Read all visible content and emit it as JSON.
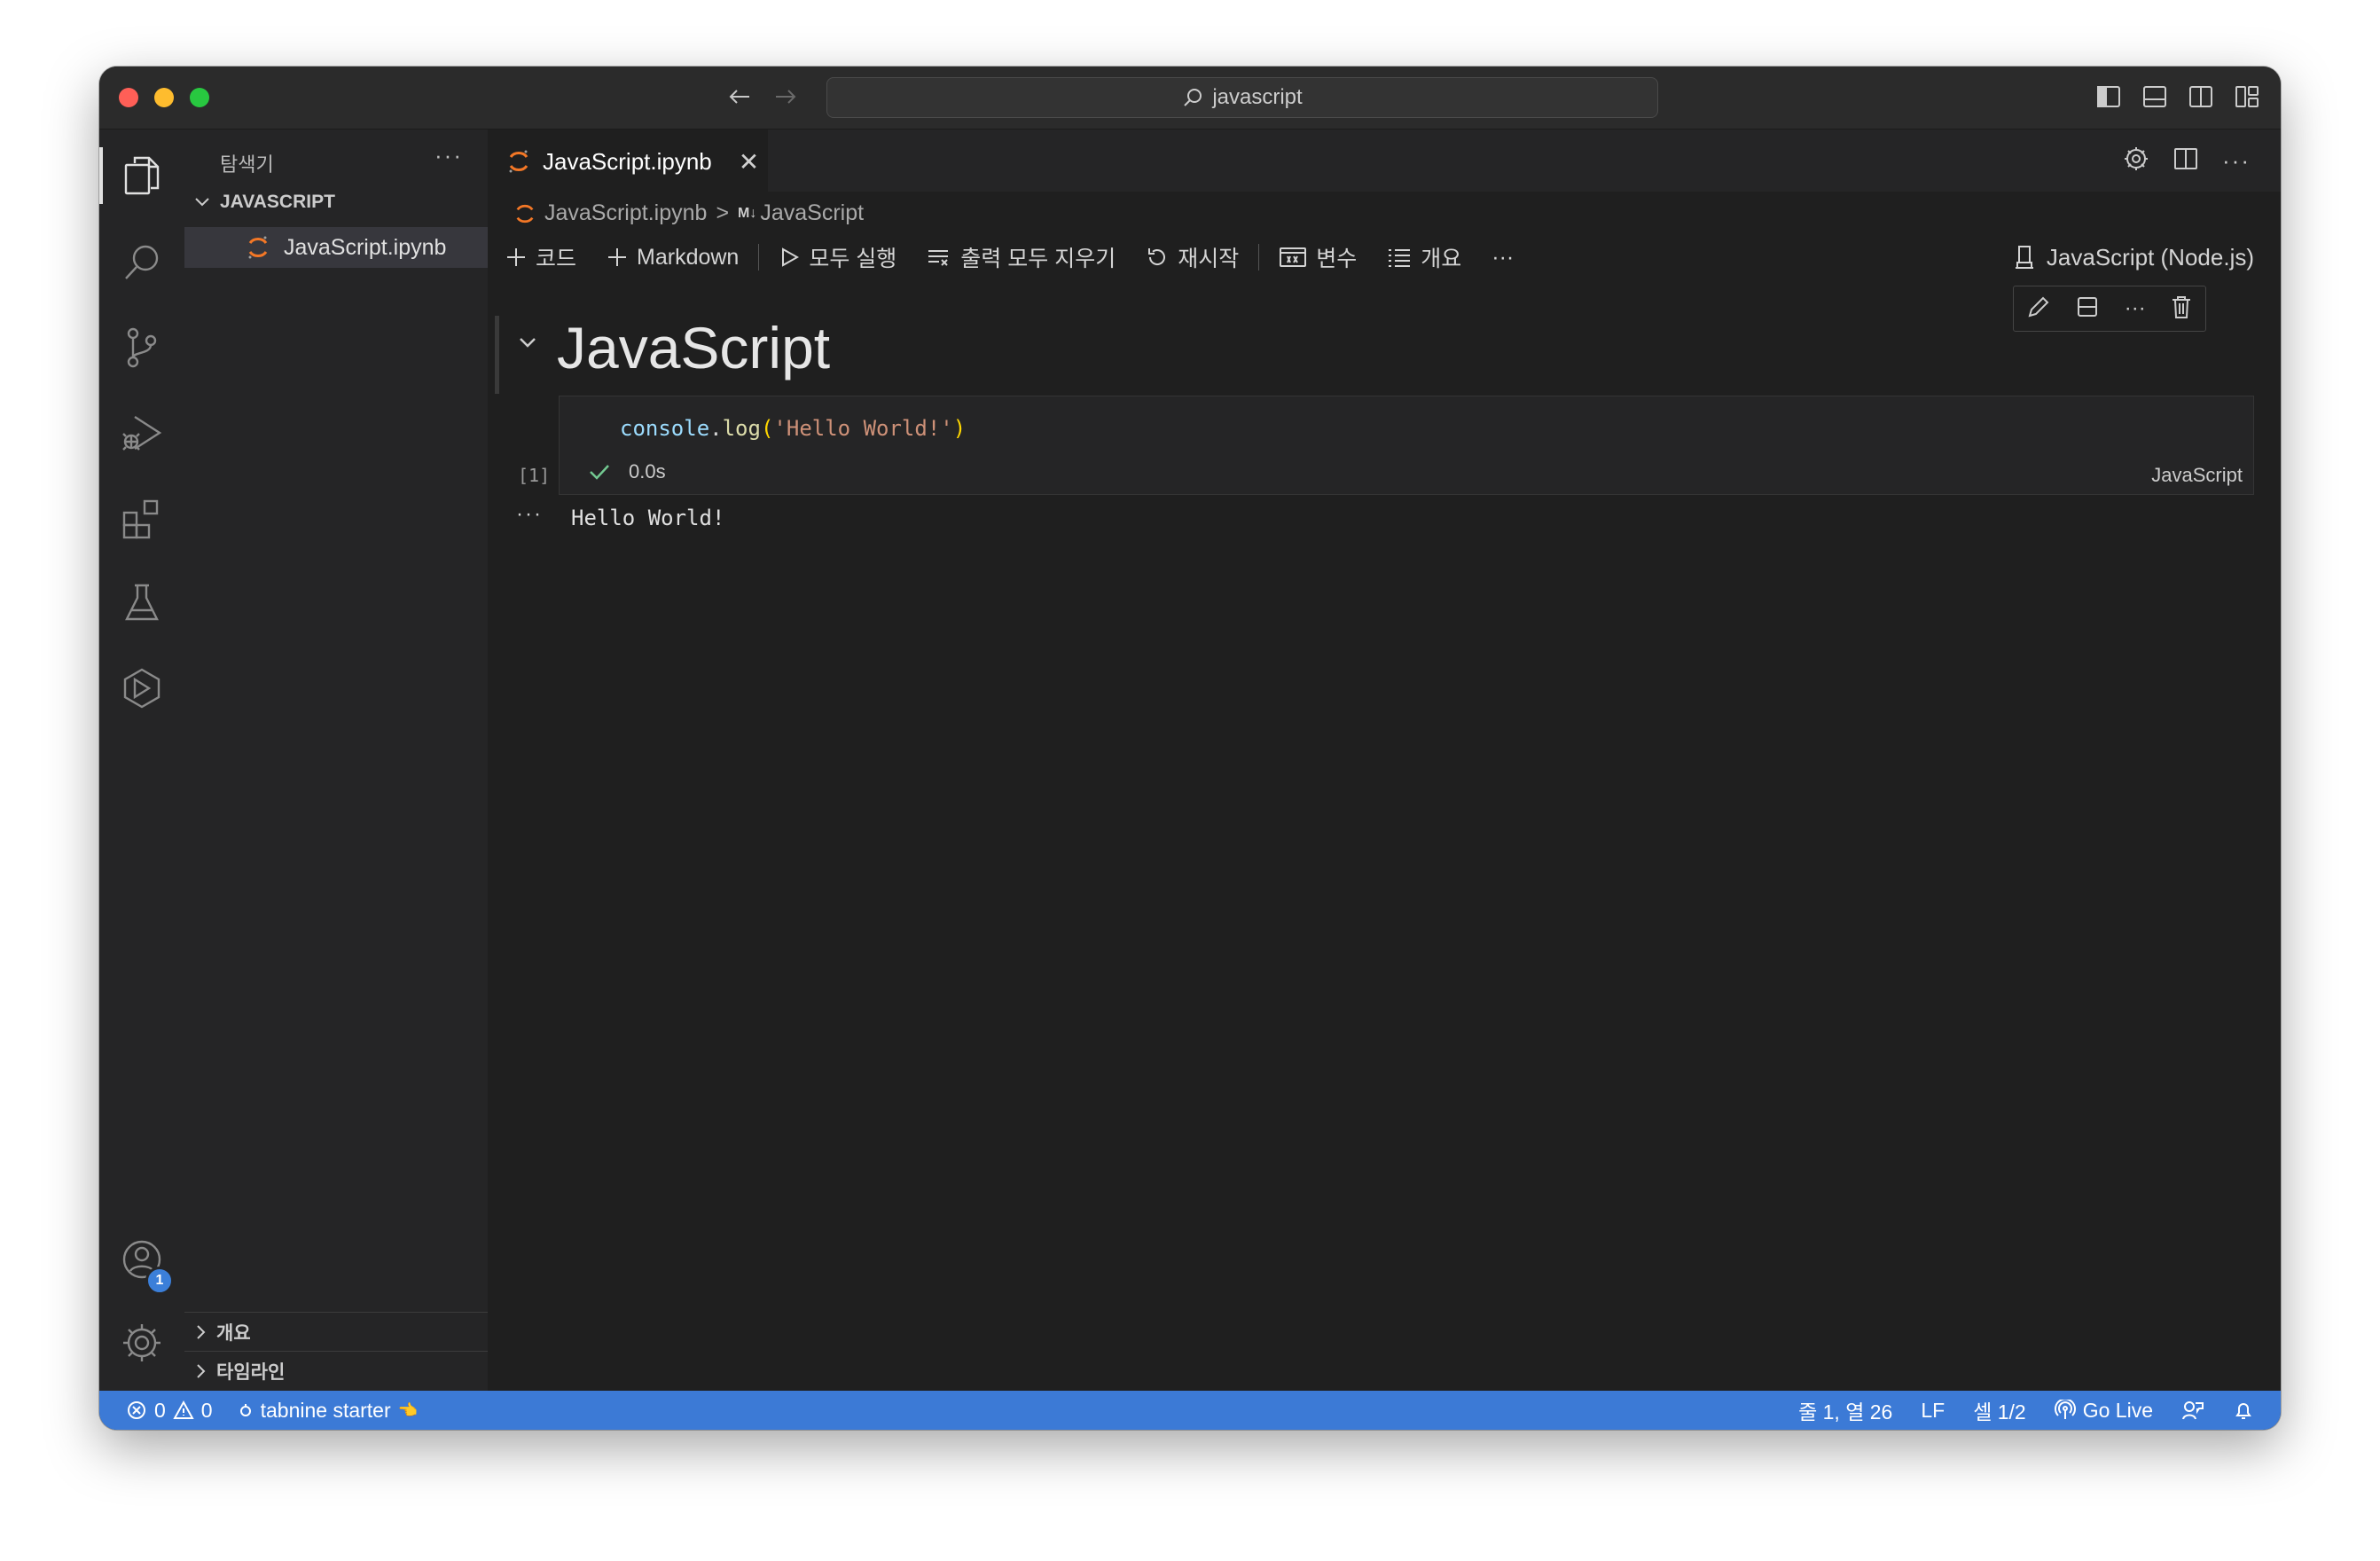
{
  "titlebar": {
    "search_text": "javascript"
  },
  "sidebar": {
    "title": "탐색기",
    "more": "···",
    "folder_name": "JAVASCRIPT",
    "files": [
      {
        "name": "JavaScript.ipynb",
        "icon": "jupyter-icon"
      }
    ],
    "sections": [
      "개요",
      "타임라인"
    ]
  },
  "tabs": [
    {
      "label": "JavaScript.ipynb",
      "close": "✕"
    }
  ],
  "breadcrumb": {
    "file": "JavaScript.ipynb",
    "separator": ">",
    "md_badge": "M↓",
    "section": "JavaScript"
  },
  "toolbar": {
    "add_code": "코드",
    "add_markdown": "Markdown",
    "run_all": "모두 실행",
    "clear_outputs": "출력 모두 지우기",
    "restart": "재시작",
    "variables": "변수",
    "outline": "개요",
    "more": "···",
    "kernel": "JavaScript (Node.js)"
  },
  "markdown_cell": {
    "heading": "JavaScript"
  },
  "code_cell": {
    "code": {
      "ident": "console",
      "dot": ".",
      "fn": "log",
      "open": "(",
      "str": "'Hello World!'",
      "close": ")"
    },
    "exec_count": "[1]",
    "duration": "0.0s",
    "language": "JavaScript",
    "output_dots": "···",
    "output": "Hello World!"
  },
  "activity_badge": "1",
  "statusbar": {
    "errors": "0",
    "warnings": "0",
    "tabnine": "tabnine starter",
    "tabnine_emoji": "👈",
    "position": "줄 1, 열 26",
    "eol": "LF",
    "cell": "셀 1/2",
    "golive": "Go Live"
  },
  "colors": {
    "statusbar": "#3c7ad6",
    "background": "#1f1f1f",
    "sidebar": "#252526",
    "accent_jupyter": "#f37726"
  }
}
